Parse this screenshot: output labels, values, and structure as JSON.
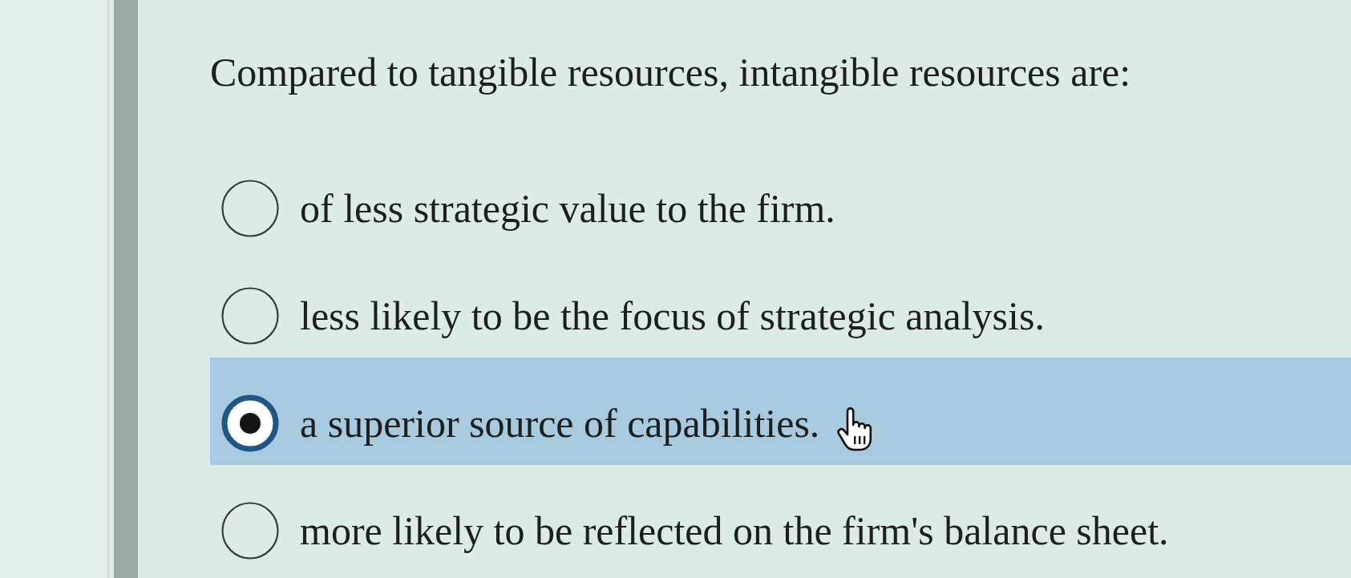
{
  "question": {
    "text": "Compared to tangible resources, intangible resources are:"
  },
  "options": [
    {
      "label": "of less strategic value to the firm.",
      "selected": false
    },
    {
      "label": "less likely to be the focus of strategic analysis.",
      "selected": false
    },
    {
      "label": "a superior source of capabilities.",
      "selected": true
    },
    {
      "label": "more likely to be reflected on the firm's balance sheet.",
      "selected": false
    }
  ]
}
